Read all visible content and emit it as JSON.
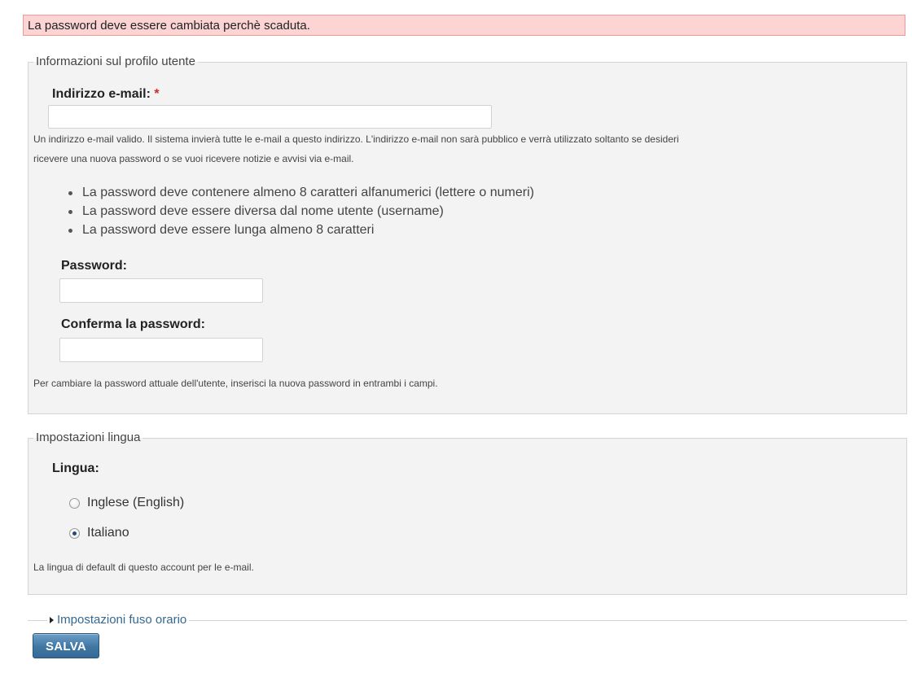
{
  "error_banner": {
    "message": "La password deve essere cambiata perchè scaduta."
  },
  "profile_section": {
    "legend": "Informazioni sul profilo utente",
    "email_label": "Indirizzo e-mail:",
    "required_marker": "*",
    "email_value": "",
    "email_description_line1": "Un indirizzo e-mail valido. Il sistema invierà tutte le e-mail a questo indirizzo. L'indirizzo e-mail non sarà pubblico e verrà utilizzato soltanto se desideri",
    "email_description_line2": "ricevere una nuova password o se vuoi ricevere notizie e avvisi via e-mail.",
    "password_rules": [
      "La password deve contenere almeno 8 caratteri alfanumerici (lettere o numeri)",
      "La password deve essere diversa dal nome utente (username)",
      "La password deve essere lunga almeno 8 caratteri"
    ],
    "password_label": "Password:",
    "password_value": "",
    "confirm_label": "Conferma la password:",
    "confirm_value": "",
    "password_help": "Per cambiare la password attuale dell'utente, inserisci la nuova password in entrambi i campi."
  },
  "language_section": {
    "legend": "Impostazioni lingua",
    "label": "Lingua:",
    "options": [
      {
        "label": "Inglese (English)",
        "checked": false
      },
      {
        "label": "Italiano",
        "checked": true
      }
    ],
    "description": "La lingua di default di questo account per le e-mail."
  },
  "timezone_section": {
    "legend": "Impostazioni fuso orario",
    "collapsed": true
  },
  "save_button": {
    "label": "SALVA"
  },
  "colors": {
    "error_background": "#fbd4d3",
    "link": "#35688f",
    "button": "#3f76a3",
    "required": "#cc2a2a"
  },
  "icons": {
    "collapse_toggle": "triangle-right-icon"
  }
}
